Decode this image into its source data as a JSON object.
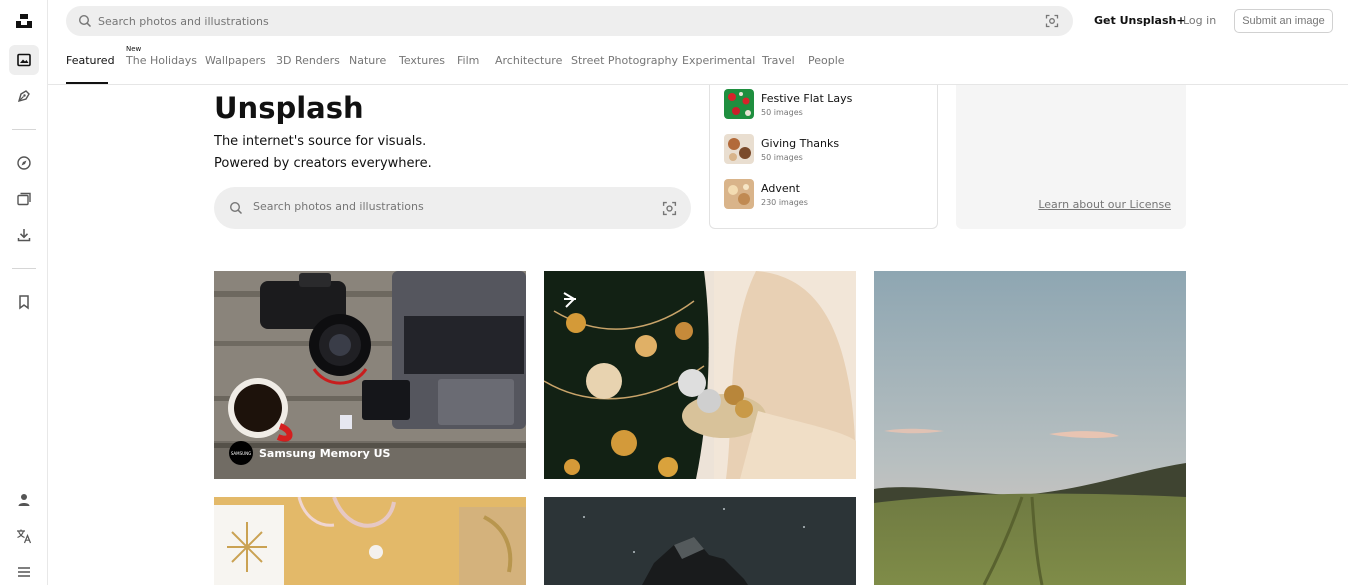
{
  "header": {
    "search_placeholder": "Search photos and illustrations",
    "get_plus": "Get Unsplash+",
    "login": "Log in",
    "submit": "Submit an image"
  },
  "tabs": [
    {
      "label": "Featured",
      "active": true
    },
    {
      "label": "The Holidays",
      "badge": "New"
    },
    {
      "label": "Wallpapers"
    },
    {
      "label": "3D Renders"
    },
    {
      "label": "Nature"
    },
    {
      "label": "Textures"
    },
    {
      "label": "Film"
    },
    {
      "label": "Architecture"
    },
    {
      "label": "Street Photography"
    },
    {
      "label": "Experimental"
    },
    {
      "label": "Travel"
    },
    {
      "label": "People"
    }
  ],
  "hero": {
    "title": "Unsplash",
    "line1": "The internet's source for visuals.",
    "line2": "Powered by creators everywhere.",
    "search_placeholder": "Search photos and illustrations"
  },
  "collections": [
    {
      "name": "Festive Flat Lays",
      "count": "50 images"
    },
    {
      "name": "Giving Thanks",
      "count": "50 images"
    },
    {
      "name": "Advent",
      "count": "230 images"
    }
  ],
  "license": {
    "link": "Learn about our License"
  },
  "photos": {
    "first_author": "Samsung Memory US",
    "first_avatar": "SAMSUNG"
  },
  "sidebar_icons": [
    "unsplash-logo-icon",
    "photos-icon",
    "illustrations-icon",
    "explore-icon",
    "collections-icon",
    "download-icon",
    "bookmark-icon",
    "user-icon",
    "language-icon",
    "menu-icon"
  ],
  "colors": {
    "accent": "#111111",
    "muted": "#767676",
    "search_bg": "#eeeeee"
  }
}
